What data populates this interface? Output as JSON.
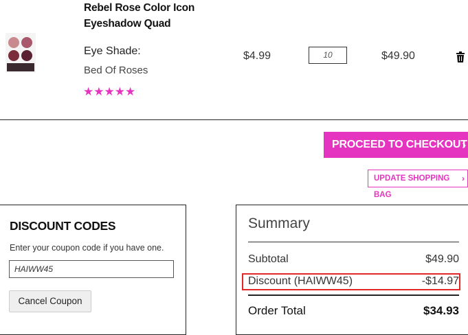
{
  "cart_item": {
    "name": "Rebel Rose Color Icon Eyeshadow Quad",
    "shade_label": "Eye Shade:",
    "shade_value": "Bed Of Roses",
    "rating_stars": "★★★★★",
    "rating": 5,
    "unit_price": "$4.99",
    "quantity": "10",
    "line_total": "$49.90",
    "thumbnail_icon": "eyeshadow-palette-image",
    "delete_icon": "trash-icon"
  },
  "actions": {
    "checkout_label": "PROCEED TO CHECKOUT",
    "checkout_chevron": "›",
    "update_label": "UPDATE SHOPPING BAG",
    "update_chevron": "›"
  },
  "discount": {
    "title": "DISCOUNT CODES",
    "help_text": "Enter your coupon code if you have one.",
    "code_value": "HAIWW45",
    "cancel_label": "Cancel Coupon"
  },
  "summary": {
    "title": "Summary",
    "subtotal_label": "Subtotal",
    "subtotal_value": "$49.90",
    "discount_label": "Discount (HAIWW45)",
    "discount_value": "-$14.97",
    "total_label": "Order Total",
    "total_value": "$34.93"
  },
  "colors": {
    "accent": "#e534c0",
    "highlight": "#e32626"
  }
}
